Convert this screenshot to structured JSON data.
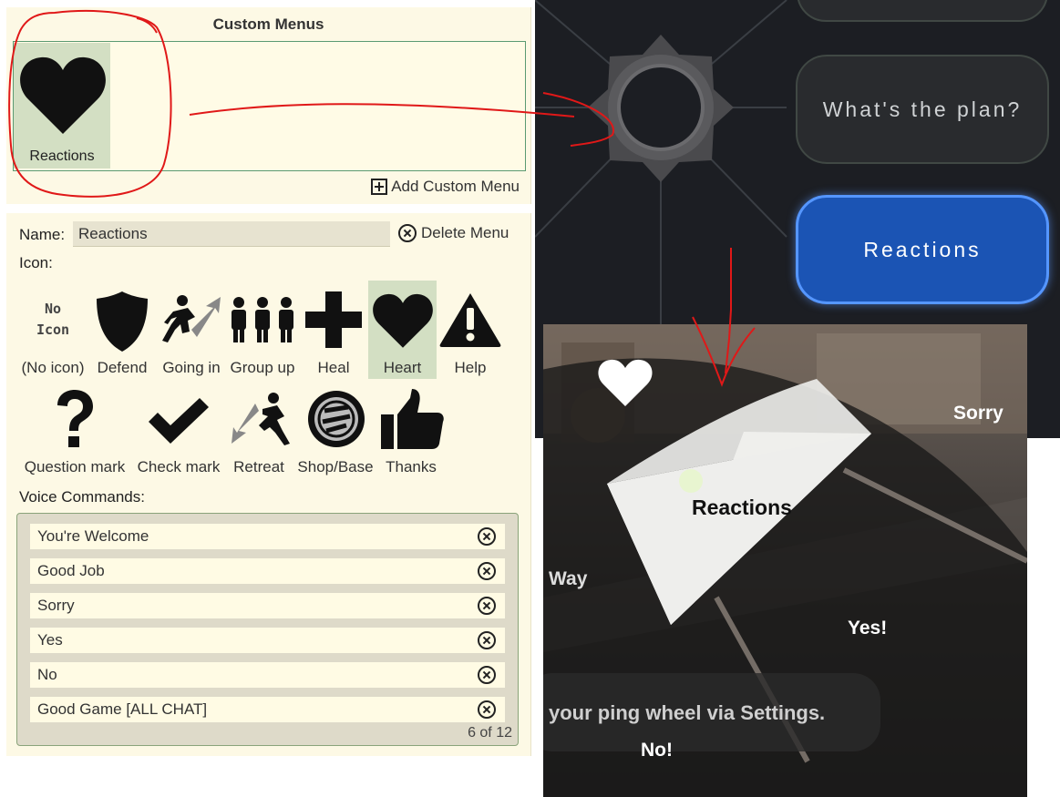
{
  "custom_menus": {
    "title": "Custom Menus",
    "tiles": [
      {
        "label": "Reactions",
        "icon": "heart-icon"
      }
    ],
    "add_label": "Add Custom Menu"
  },
  "editor": {
    "name_label": "Name:",
    "name_value": "Reactions",
    "delete_label": "Delete Menu",
    "icon_label": "Icon:",
    "no_icon_glyph": "No\nIcon",
    "icons": [
      {
        "label": "(No icon)",
        "icon": "no-icon"
      },
      {
        "label": "Defend",
        "icon": "shield-icon"
      },
      {
        "label": "Going in",
        "icon": "running-arrow-icon"
      },
      {
        "label": "Group up",
        "icon": "group-icon"
      },
      {
        "label": "Heal",
        "icon": "plus-icon"
      },
      {
        "label": "Heart",
        "icon": "heart-icon",
        "selected": true
      },
      {
        "label": "Help",
        "icon": "warning-icon"
      },
      {
        "label": "Question mark",
        "icon": "question-icon"
      },
      {
        "label": "Check mark",
        "icon": "check-icon"
      },
      {
        "label": "Retreat",
        "icon": "retreat-icon"
      },
      {
        "label": "Shop/Base",
        "icon": "shop-icon"
      },
      {
        "label": "Thanks",
        "icon": "thumbs-up-icon"
      }
    ],
    "voice_label": "Voice Commands:",
    "voice_commands": [
      "You're Welcome",
      "Good Job",
      "Sorry",
      "Yes",
      "No",
      "Good Game [ALL CHAT]"
    ],
    "count": "6 of 12"
  },
  "game_menu": {
    "items": [
      "What's the plan?",
      "Reactions"
    ],
    "selected": "Reactions"
  },
  "ping_wheel": {
    "center_label": "Reactions",
    "labels": [
      "Sorry",
      "Way",
      "Yes!",
      "No!"
    ],
    "hint": "your ping wheel via Settings.",
    "icon": "heart-icon"
  },
  "colors": {
    "panel_bg": "#fdf9e5",
    "selected_bg": "#d3dfc3",
    "accent_green": "#5b9a72",
    "game_blue": "#1b54b4",
    "annotation_red": "#e01818"
  }
}
